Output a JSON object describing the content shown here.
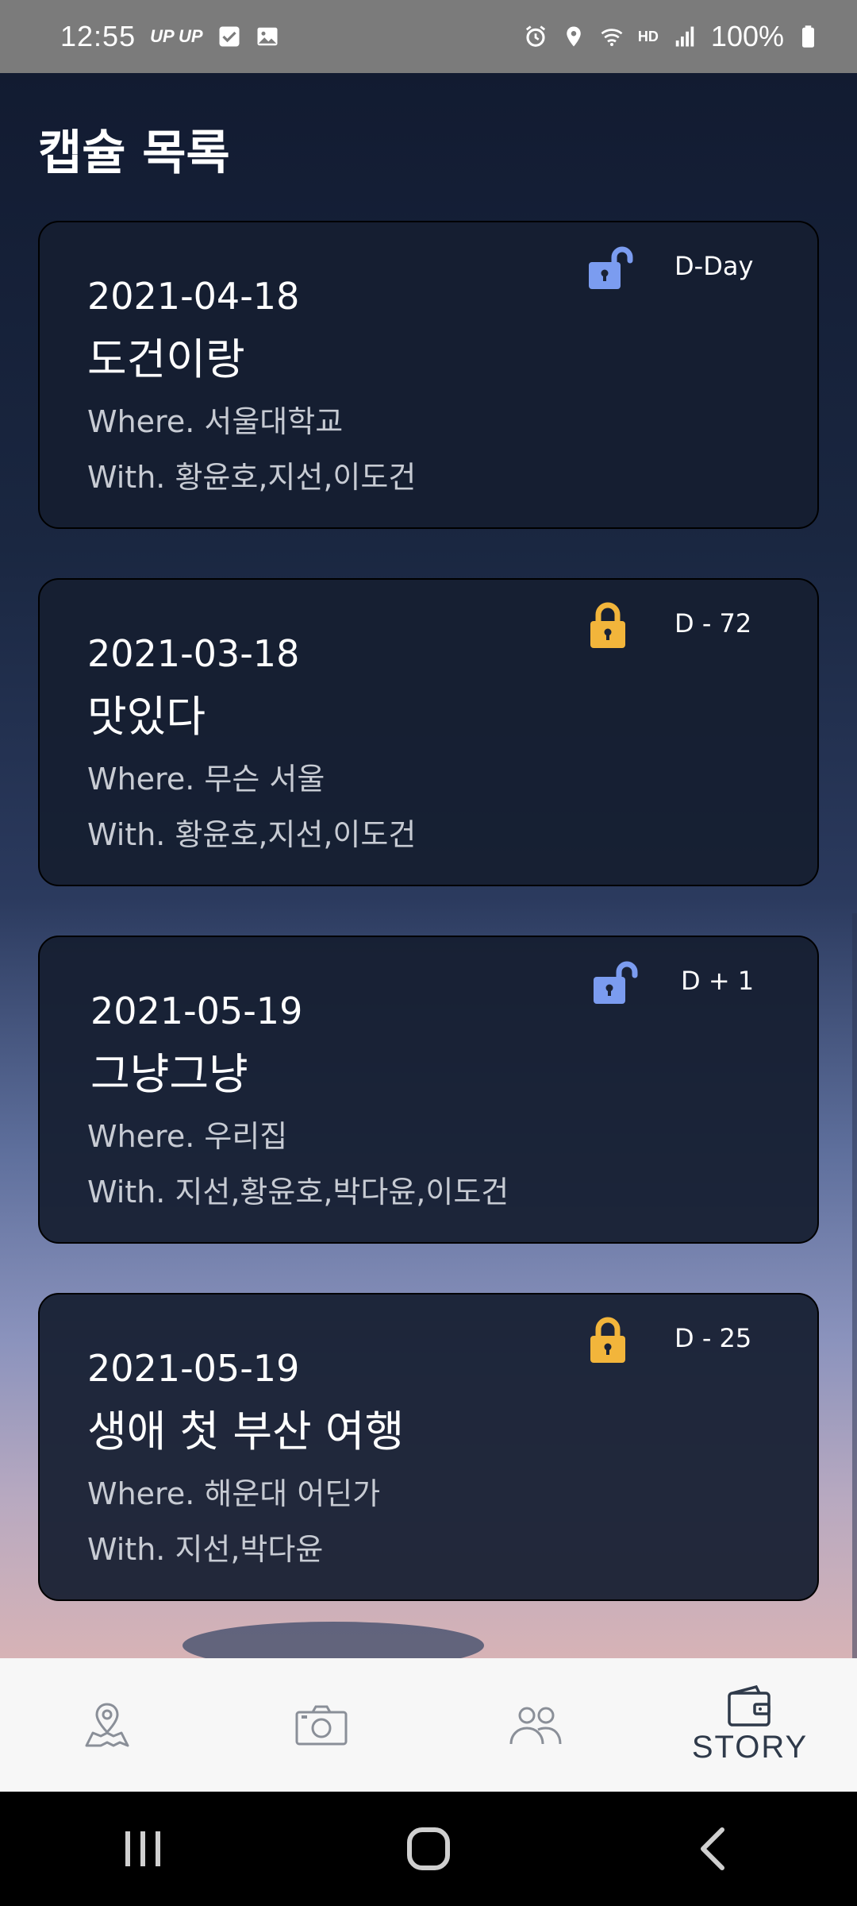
{
  "status_bar": {
    "time": "12:55",
    "up_label": "UP UP",
    "battery": "100%",
    "hd_label": "HD"
  },
  "page": {
    "title": "캡슐 목록"
  },
  "capsules": [
    {
      "date": "2021-04-18",
      "title": "도건이랑",
      "where": "Where. 서울대학교",
      "with": "With. 황윤호,지선,이도건",
      "dday": "D-Day",
      "lock": "unlocked",
      "lock_color": "#7b9cf0"
    },
    {
      "date": "2021-03-18",
      "title": "맛있다",
      "where": "Where. 무슨 서울",
      "with": "With. 황윤호,지선,이도건",
      "dday": "D - 72",
      "lock": "locked",
      "lock_color": "#f2b53b"
    },
    {
      "date": "2021-05-19",
      "title": "그냥그냥",
      "where": "Where. 우리집",
      "with": "With. 지선,황윤호,박다윤,이도건",
      "dday": "D + 1",
      "lock": "unlocked",
      "lock_color": "#7b9cf0"
    },
    {
      "date": "2021-05-19",
      "title": "생애 첫 부산 여행",
      "where": "Where. 해운대 어딘가",
      "with": "With. 지선,박다윤",
      "dday": "D - 25",
      "lock": "locked",
      "lock_color": "#f2b53b"
    }
  ],
  "bottom_nav": {
    "items": [
      {
        "icon": "map-pin-icon"
      },
      {
        "icon": "camera-icon"
      },
      {
        "icon": "people-icon"
      },
      {
        "icon": "wallet-icon",
        "label": "STORY",
        "active": true
      }
    ]
  }
}
